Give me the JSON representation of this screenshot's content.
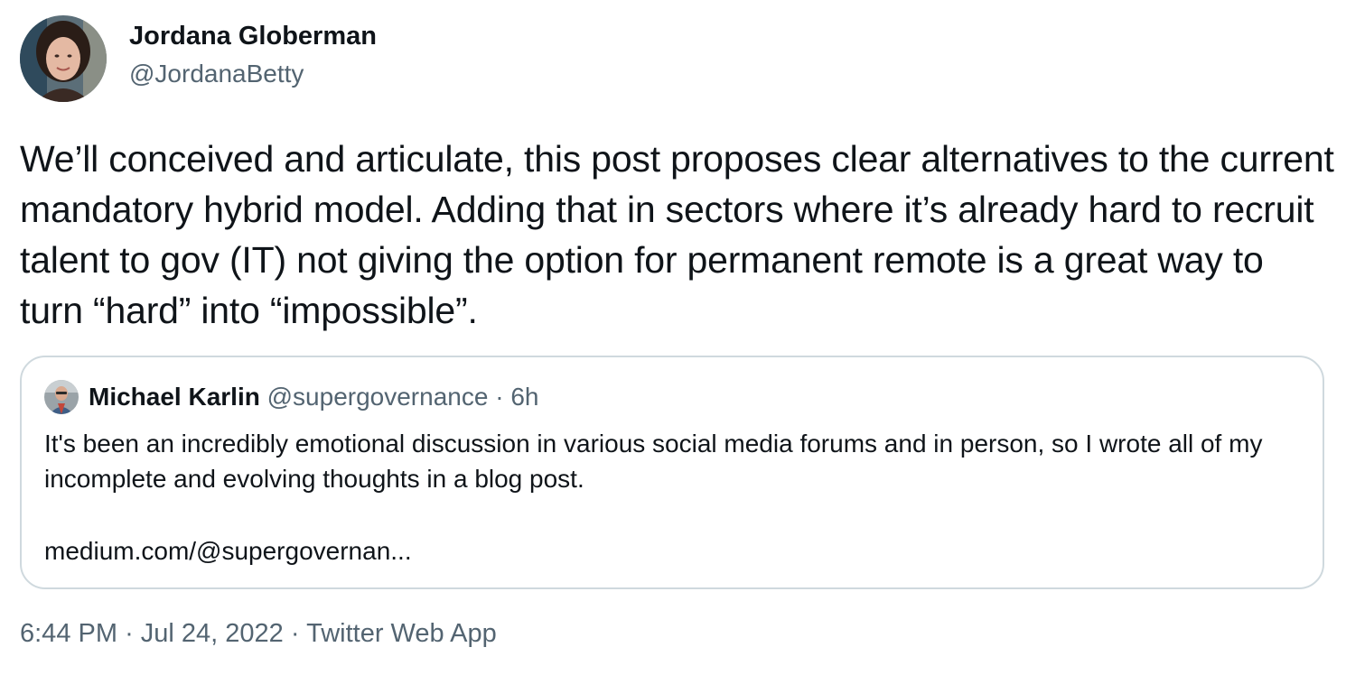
{
  "tweet": {
    "author": {
      "name": "Jordana Globerman",
      "handle": "@JordanaBetty"
    },
    "text": "We’ll conceived and articulate, this post proposes clear alternatives to the current mandatory hybrid model. Adding that in sectors where it’s already hard to recruit talent to gov (IT) not giving the option for permanent remote is a great way to turn “hard” into “impossible”.",
    "quoted": {
      "name": "Michael Karlin",
      "handle": "@supergovernance",
      "separator": "·",
      "time": "6h",
      "text": "It's been an incredibly emotional discussion in various social media forums and in person, so I wrote all of my incomplete and evolving thoughts in a blog post.",
      "link": "medium.com/@supergovernan..."
    },
    "footer": {
      "time": "6:44 PM",
      "separator": "·",
      "date": "Jul 24, 2022",
      "source": "Twitter Web App"
    }
  },
  "colors": {
    "primary_text": "#0f1419",
    "secondary_text": "#536471",
    "border": "#cfd9de"
  }
}
